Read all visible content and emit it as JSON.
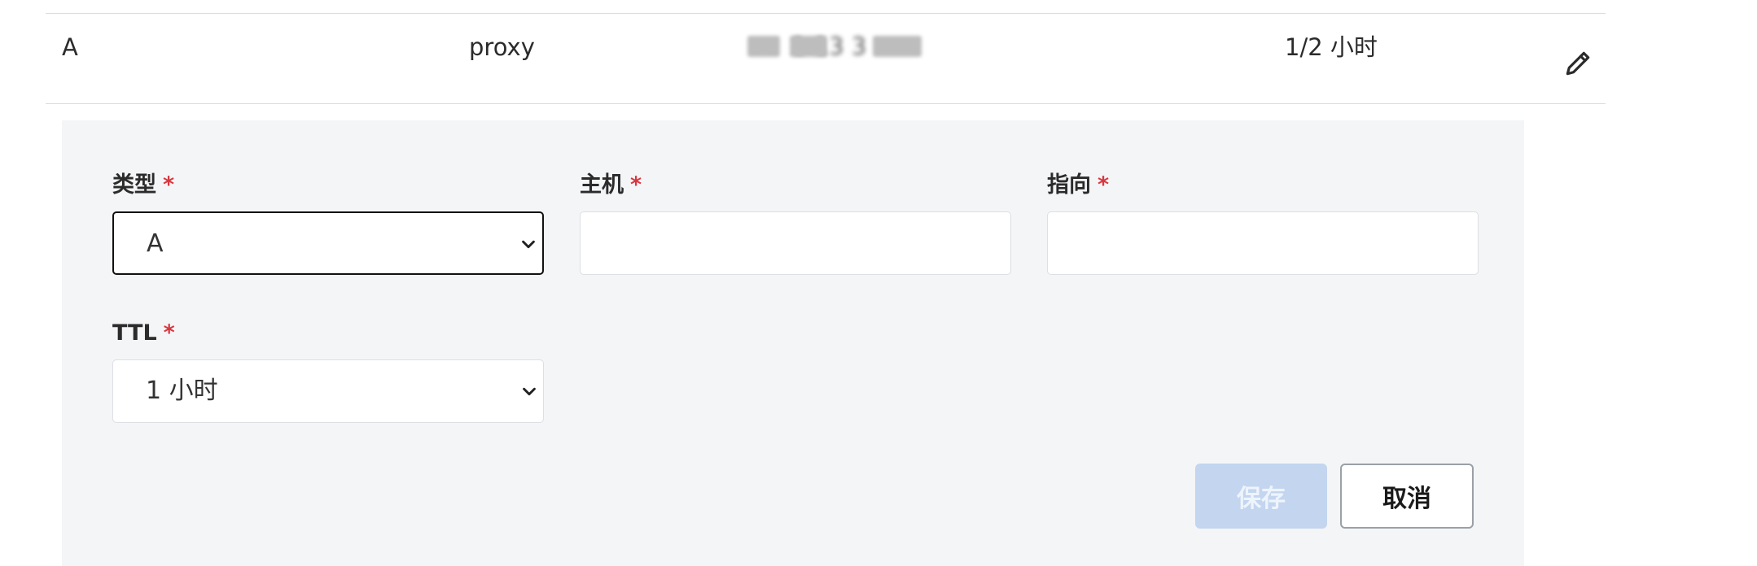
{
  "record_row": {
    "type": "A",
    "host": "proxy",
    "value_redacted": "1 13 3",
    "ttl": "1/2 小时"
  },
  "icons": {
    "edit": "pencil-icon",
    "select_chevron": "chevron-down-icon"
  },
  "form": {
    "type_field": {
      "label": "类型",
      "required_mark": "*",
      "value": "A"
    },
    "host_field": {
      "label": "主机",
      "required_mark": "*",
      "value": ""
    },
    "target_field": {
      "label": "指向",
      "required_mark": "*",
      "value": ""
    },
    "ttl_field": {
      "label": "TTL",
      "required_mark": "*",
      "value": "1 小时"
    }
  },
  "buttons": {
    "save_label": "保存",
    "cancel_label": "取消"
  },
  "colors": {
    "panel_bg": "#f4f5f7",
    "required": "#d9363e",
    "save_disabled_bg": "#c3d5ef"
  }
}
